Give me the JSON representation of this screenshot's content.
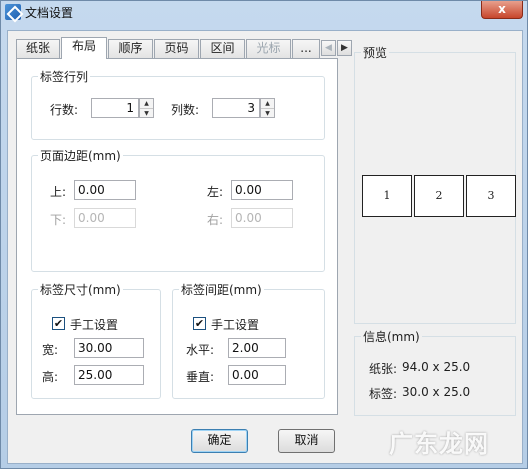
{
  "window": {
    "title": "文档设置",
    "close_label": "x"
  },
  "tabs": [
    {
      "label": "纸张",
      "state": "normal"
    },
    {
      "label": "布局",
      "state": "active"
    },
    {
      "label": "顺序",
      "state": "normal"
    },
    {
      "label": "页码",
      "state": "normal"
    },
    {
      "label": "区间",
      "state": "normal"
    },
    {
      "label": "光标",
      "state": "disabled"
    },
    {
      "label": "...",
      "state": "normal"
    }
  ],
  "tab_scroll": {
    "left": "◀",
    "right": "▶"
  },
  "label_rows_cols": {
    "title": "标签行列",
    "rows_label": "行数:",
    "rows_value": "1",
    "cols_label": "列数:",
    "cols_value": "3"
  },
  "page_margins": {
    "title": "页面边距(mm)",
    "top_label": "上:",
    "top_value": "0.00",
    "left_label": "左:",
    "left_value": "0.00",
    "bottom_label": "下:",
    "bottom_value": "0.00",
    "right_label": "右:",
    "right_value": "0.00"
  },
  "label_size": {
    "title": "标签尺寸(mm)",
    "manual_label": "手工设置",
    "manual_checked": true,
    "width_label": "宽:",
    "width_value": "30.00",
    "height_label": "高:",
    "height_value": "25.00"
  },
  "label_spacing": {
    "title": "标签间距(mm)",
    "manual_label": "手工设置",
    "manual_checked": true,
    "horizontal_label": "水平:",
    "horizontal_value": "2.00",
    "vertical_label": "垂直:",
    "vertical_value": "0.00"
  },
  "preview": {
    "title": "预览",
    "cells": [
      "1",
      "2",
      "3"
    ]
  },
  "info": {
    "title": "信息(mm)",
    "paper_label": "纸张:",
    "paper_value": "94.0 x 25.0",
    "label_label": "标签:",
    "label_value": "30.0 x 25.0"
  },
  "buttons": {
    "ok": "确定",
    "cancel": "取消"
  },
  "watermark": "广东龙网",
  "icons": {
    "app": "document-settings-icon",
    "check": "✔",
    "spin_up": "▲",
    "spin_down": "▼"
  }
}
